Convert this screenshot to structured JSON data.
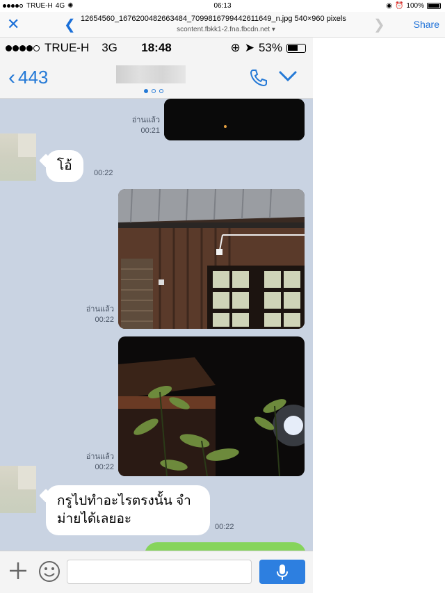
{
  "outer_status": {
    "carrier": "TRUE-H",
    "network": "4G",
    "time": "06:13",
    "battery": "100%"
  },
  "viewer": {
    "close_icon": "close-icon",
    "title": "12654560_1676200482663484_7099816799442611649_n.jpg 540×960 pixels",
    "subtitle": "scontent.fbkk1-2.fna.fbcdn.net ▾",
    "share_label": "Share"
  },
  "phone_status": {
    "carrier": "TRUE-H",
    "network": "3G",
    "time": "18:48",
    "battery": "53%"
  },
  "chat_header": {
    "back_count": "443"
  },
  "messages": [
    {
      "type": "image",
      "side": "right",
      "read": "อ่านแล้ว",
      "time": "00:21"
    },
    {
      "type": "text",
      "side": "left",
      "text": "โอ้",
      "time": "00:22"
    },
    {
      "type": "image",
      "side": "right",
      "read": "อ่านแล้ว",
      "time": "00:22"
    },
    {
      "type": "image",
      "side": "right",
      "read": "อ่านแล้ว",
      "time": "00:22"
    },
    {
      "type": "text",
      "side": "left",
      "text_line1": "กรูไปทำอะไรตรงนั้น จำ",
      "text_line2": "ม่ายได้เลยอะ",
      "time": "00:22"
    }
  ],
  "colors": {
    "accent": "#2479d6",
    "chat_background": "#c9d3e2",
    "outgoing_bubble": "#86d45b",
    "send_button": "#2d7fe0"
  }
}
